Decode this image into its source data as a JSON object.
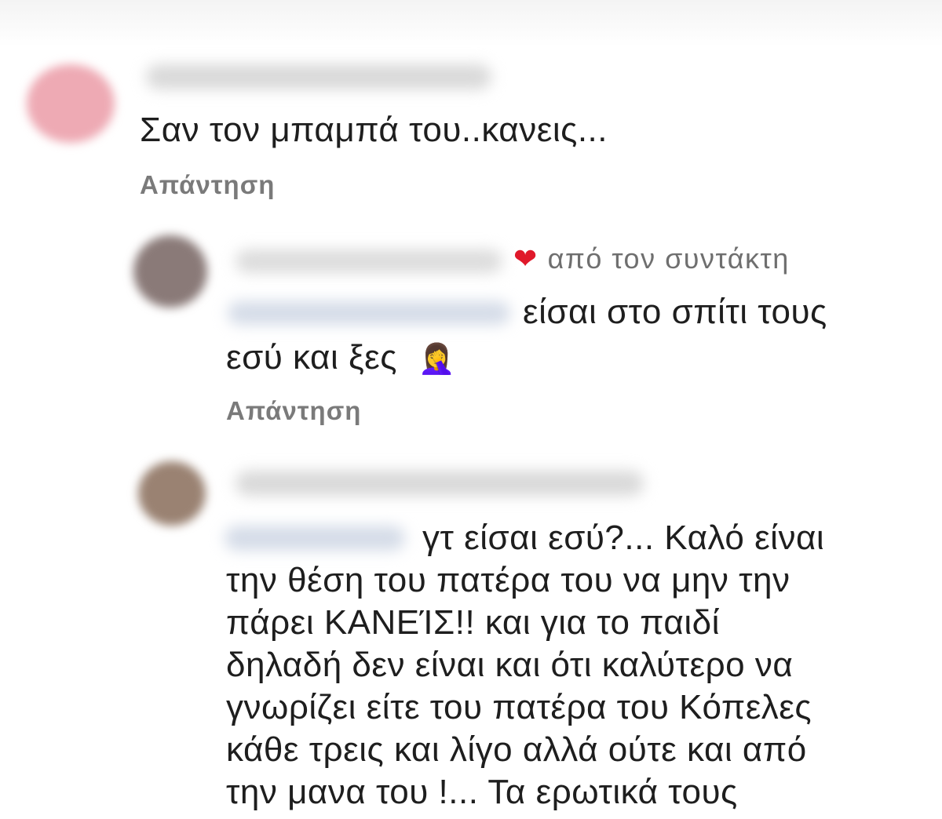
{
  "comments": [
    {
      "text": "Σαν τον μπαμπά του..κανεις...",
      "reply_label": "Απάντηση"
    },
    {
      "liked_label": "από τον συντάκτη",
      "line1": "είσαι στο σπίτι τους",
      "line2": "εσύ και ξες",
      "emoji": "🤦‍♀️",
      "reply_label": "Απάντηση"
    },
    {
      "lines": [
        "γτ είσαι εσύ?... Καλό είναι",
        "την θέση του πατέρα του να μην την",
        "πάρει ΚΑΝΕΊΣ!! και για το παιδί",
        "δηλαδή δεν είναι και ότι καλύτερο να",
        "γνωρίζει είτε του πατέρα του Κόπελες",
        "κάθε τρεις και λίγο αλλά ούτε και από",
        "την μανα του !... Τα ερωτικά τους"
      ]
    }
  ],
  "colors": {
    "heart": "#e0182a",
    "reply_text": "#7a7a7a",
    "body_text": "#1e1e1e"
  }
}
